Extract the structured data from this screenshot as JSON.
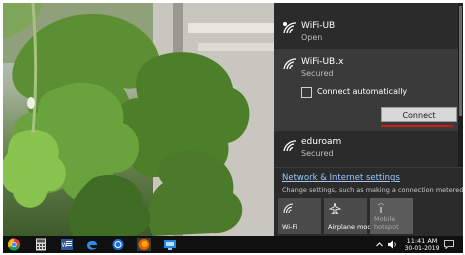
{
  "networks": [
    {
      "name": "WiFi-UB",
      "status": "Open"
    },
    {
      "name": "WiFi-UB.x",
      "status": "Secured",
      "connect_automatically_label": "Connect automatically",
      "connect_label": "Connect"
    },
    {
      "name": "eduroam",
      "status": "Secured"
    }
  ],
  "settings": {
    "link": "Network & Internet settings",
    "description": "Change settings, such as making a connection metered."
  },
  "quick_actions": [
    {
      "label": "Wi-Fi",
      "icon": "wifi-icon"
    },
    {
      "label": "Airplane mode",
      "icon": "airplane-icon"
    },
    {
      "label": "Mobile\nhotspot",
      "icon": "hotspot-icon"
    }
  ],
  "taskbar": {
    "apps": [
      "chrome-icon",
      "calculator-icon",
      "word-icon",
      "edge-icon",
      "app-icon",
      "firefox-icon",
      "remote-desktop-icon"
    ],
    "time": "11:41 AM",
    "date": "30-01-2019"
  },
  "colors": {
    "flyout_bg": "#2b2b2b",
    "link": "#9ec7ff",
    "accent_red": "#d11a1a"
  }
}
